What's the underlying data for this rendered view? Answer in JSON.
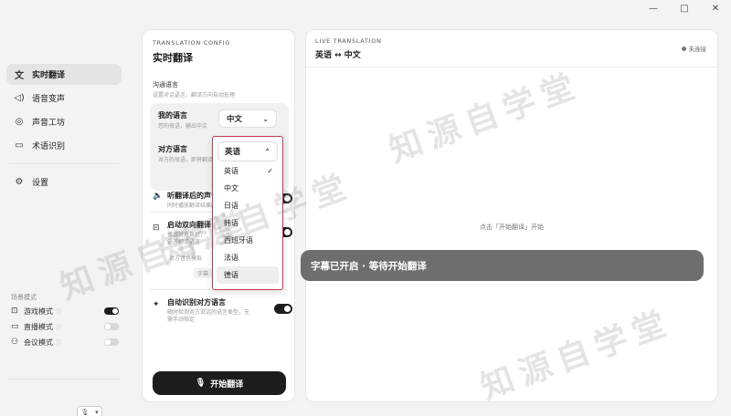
{
  "window": {
    "controls": [
      {
        "name": "minimize-button",
        "glyph": "—"
      },
      {
        "name": "maximize-button",
        "glyph": "□"
      },
      {
        "name": "close-button",
        "glyph": "✕"
      }
    ]
  },
  "sidebar": {
    "items": [
      {
        "label": "实时翻译",
        "icon": "translate-icon",
        "glyph": "文",
        "active": true
      },
      {
        "label": "语音变声",
        "icon": "voice-wave-icon",
        "glyph": "◁)",
        "active": false
      },
      {
        "label": "声音工坊",
        "icon": "voice-workshop-icon",
        "glyph": "◎",
        "active": false
      },
      {
        "label": "术语识别",
        "icon": "book-icon",
        "glyph": "▭",
        "active": false
      }
    ],
    "settings_label": "设置",
    "scenes_title": "场景模式",
    "scenes": [
      {
        "label": "游戏模式",
        "icon": "gamepad-icon",
        "glyph": "⊡",
        "on": true
      },
      {
        "label": "直播模式",
        "icon": "broadcast-icon",
        "glyph": "▭",
        "on": false
      },
      {
        "label": "会议模式",
        "icon": "people-icon",
        "glyph": "⚇",
        "on": false
      }
    ]
  },
  "config": {
    "eyebrow": "TRANSLATION CONFIG",
    "title": "实时翻译",
    "group_title": "沟通语言",
    "group_desc": "设置对话语言，翻译方向自动处理",
    "my_language": {
      "label": "我的语言",
      "sub": "您的母语，输出中文",
      "value": "中文"
    },
    "other_language": {
      "label": "对方语言",
      "sub": "对方的母语，即将翻译",
      "value": "英语"
    },
    "listen": {
      "title": "听翻译后的声音",
      "sub": "同时播放翻译结果的语音"
    },
    "bidirectional": {
      "title": "启动双向翻译",
      "sub1": "播放对方声音，",
      "sub2": "语言翻译语言",
      "extra": "对方音色模拟",
      "extra_val": "关闭",
      "chip": "字幕"
    },
    "auto_detect": {
      "title": "自动识别对方语言",
      "sub1": "随时检测对方说话的语言类型，无",
      "sub2": "需手动指定"
    },
    "start_label": "开始翻译"
  },
  "dropdown": {
    "selected": "英语",
    "options": [
      "英语",
      "中文",
      "日语",
      "韩语",
      "西班牙语",
      "法语",
      "德语"
    ],
    "checked_index": 0,
    "highlight_index": 6
  },
  "live": {
    "eyebrow": "LIVE TRANSLATION",
    "pair": "英语 ↔ 中文",
    "status": "未连接",
    "hint": "点击「开始翻译」开始",
    "subtitle": "字幕已开启 · 等待开始翻译"
  },
  "watermark": "知源自学堂"
}
